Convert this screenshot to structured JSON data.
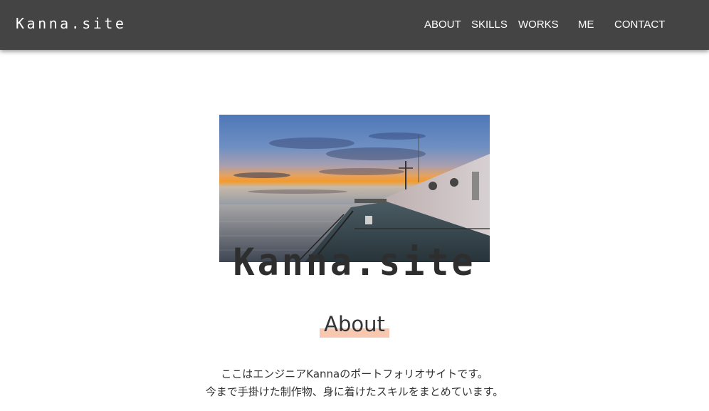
{
  "header": {
    "brand": "Kanna.site",
    "background_color": "#444444",
    "nav": [
      {
        "id": "about",
        "label": "ABOUT"
      },
      {
        "id": "skills",
        "label": "SKILLS"
      },
      {
        "id": "works",
        "label": "WORKS"
      },
      {
        "id": "me",
        "label": "ME"
      },
      {
        "id": "contact",
        "label": "CONTACT"
      }
    ]
  },
  "hero": {
    "image_description_icon": "sunset-ship-deck-image",
    "title": "Kanna.site"
  },
  "about": {
    "heading": "About",
    "highlight_color": "#f7c7af",
    "line1": "ここはエンジニアKannaのポートフォリオサイトです。",
    "line2": "今まで手掛けた制作物、身に着けたスキルをまとめています。"
  }
}
